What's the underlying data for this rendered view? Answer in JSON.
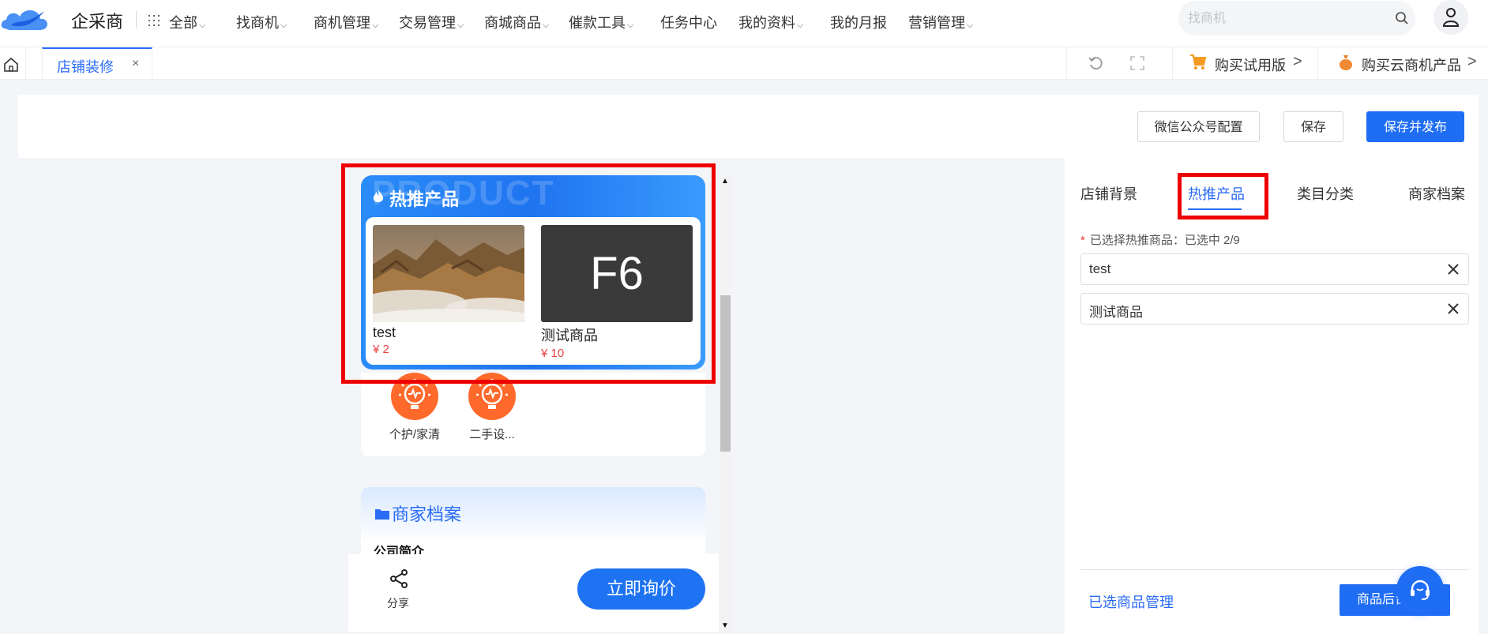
{
  "app": {
    "brand": "企采商"
  },
  "nav": {
    "items": [
      {
        "label": "全部",
        "dropdown": true
      },
      {
        "label": "找商机",
        "dropdown": true
      },
      {
        "label": "商机管理",
        "dropdown": true
      },
      {
        "label": "交易管理",
        "dropdown": true
      },
      {
        "label": "商城商品",
        "dropdown": true
      },
      {
        "label": "催款工具",
        "dropdown": true
      },
      {
        "label": "任务中心",
        "dropdown": false
      },
      {
        "label": "我的资料",
        "dropdown": true
      },
      {
        "label": "我的月报",
        "dropdown": false
      },
      {
        "label": "营销管理",
        "dropdown": true
      }
    ],
    "search_placeholder": "找商机"
  },
  "tabs": {
    "active": "店铺装修",
    "close": "×",
    "buy_trial": "购买试用版",
    "buy_cloud": "购买云商机产品",
    "chevron": ">"
  },
  "toolbar": {
    "wechat_config": "微信公众号配置",
    "save": "保存",
    "save_publish": "保存并发布"
  },
  "preview": {
    "hot": {
      "bg_text": "PRODUCT",
      "title": "热推产品",
      "products": [
        {
          "name": "test",
          "price": "¥  2",
          "image": "mountain-landscape"
        },
        {
          "name": "测试商品",
          "price": "¥  10",
          "image_text": "F6"
        }
      ]
    },
    "categories": [
      {
        "label": "个护/家清"
      },
      {
        "label": "二手设..."
      }
    ],
    "merchant": {
      "title": "商家档案",
      "company_intro": "公司简介"
    },
    "bottom": {
      "share": "分享",
      "inquiry": "立即询价"
    }
  },
  "panel": {
    "tabs": [
      {
        "label": "店铺背景",
        "active": false
      },
      {
        "label": "热推产品",
        "active": true
      },
      {
        "label": "类目分类",
        "active": false
      },
      {
        "label": "商家档案",
        "active": false
      }
    ],
    "required_mark": "*",
    "selected_label": "已选择热推商品：已选中 2/9",
    "selected_items": [
      {
        "label": "test"
      },
      {
        "label": "测试商品"
      }
    ],
    "manage_link": "已选商品管理",
    "backend_button": "商品后台"
  },
  "colors": {
    "accent": "#1f6df3",
    "highlight": "#ee0000",
    "price": "#e94141"
  }
}
